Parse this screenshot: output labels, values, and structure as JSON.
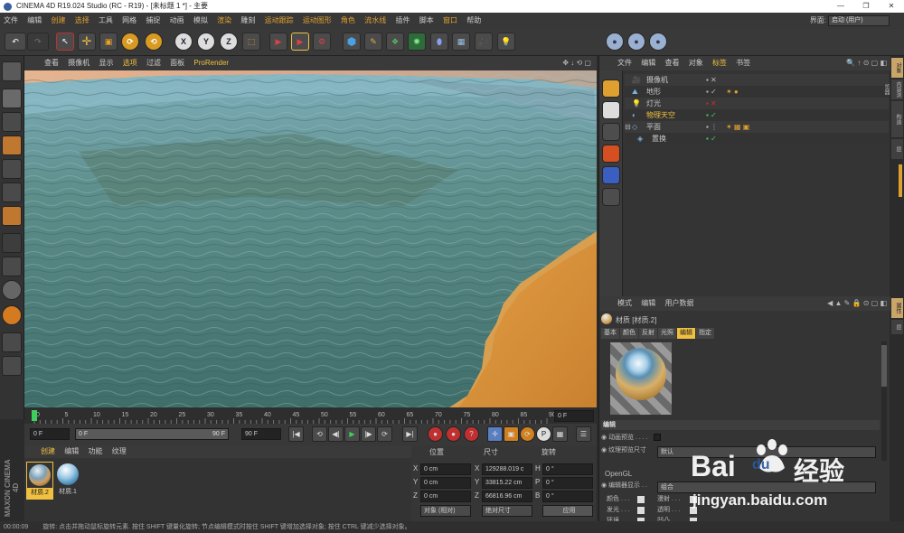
{
  "window": {
    "title": "CINEMA 4D R19.024 Studio (RC - R19) - [未标题 1 *] - 主要",
    "controls": [
      "—",
      "❐",
      "✕"
    ]
  },
  "menubar": {
    "items": [
      "文件",
      "编辑",
      "创建",
      "选择",
      "工具",
      "网格",
      "捕捉",
      "动画",
      "模拟",
      "渲染",
      "雕刻",
      "运动跟踪",
      "运动图形",
      "角色",
      "流水线",
      "插件",
      "脚本",
      "窗口",
      "帮助"
    ],
    "layout_label": "界面:",
    "layout_value": "启动 (用户)"
  },
  "toolbar": {
    "axis_x": "X",
    "axis_y": "Y",
    "axis_z": "Z"
  },
  "viewport": {
    "menu": [
      "查看",
      "摄像机",
      "显示",
      "选项",
      "过滤",
      "面板"
    ],
    "prorender": "ProRender"
  },
  "timeline": {
    "ticks": [
      "0",
      "5",
      "10",
      "15",
      "20",
      "25",
      "30",
      "35",
      "40",
      "45",
      "50",
      "55",
      "60",
      "65",
      "70",
      "75",
      "80",
      "85",
      "90"
    ],
    "end_field": "0 F",
    "current_frame": 0,
    "max_frame": 90
  },
  "playbar": {
    "start": "0 F",
    "range_start": "0 F",
    "range_end": "90 F",
    "end": "90 F"
  },
  "material_panel": {
    "tabs": [
      "创建",
      "编辑",
      "功能",
      "纹理"
    ],
    "materials": [
      {
        "name": "材质.2",
        "selected": true
      },
      {
        "name": "材质.1",
        "selected": false
      }
    ],
    "brand": [
      "MAXON",
      "CINEMA 4D"
    ]
  },
  "coords": {
    "headers": [
      "位置",
      "尺寸",
      "旋转"
    ],
    "rows": [
      {
        "axis": "X",
        "pos": "0 cm",
        "size_axis": "X",
        "size": "129288.019 c",
        "rot_axis": "H",
        "rot": "0 °"
      },
      {
        "axis": "Y",
        "pos": "0 cm",
        "size_axis": "Y",
        "size": "33815.22 cm",
        "rot_axis": "P",
        "rot": "0 °"
      },
      {
        "axis": "Z",
        "pos": "0 cm",
        "size_axis": "Z",
        "size": "66816.96 cm",
        "rot_axis": "B",
        "rot": "0 °"
      }
    ],
    "mode_select": "对象 (相对)",
    "size_select": "绝对尺寸",
    "apply": "应用"
  },
  "object_manager": {
    "menu": [
      "文件",
      "编辑",
      "查看",
      "对象",
      "标签",
      "书签"
    ],
    "objects": [
      {
        "name": "摄像机",
        "color": "#c8c8c8"
      },
      {
        "name": "地形",
        "color": "#c8c8c8"
      },
      {
        "name": "灯光",
        "color": "#c8c8c8"
      },
      {
        "name": "物理天空",
        "color": "#f0c040"
      },
      {
        "name": "平面",
        "color": "#c8c8c8"
      },
      {
        "name": "置换",
        "color": "#c8c8c8"
      }
    ]
  },
  "attribute_manager": {
    "menu": [
      "模式",
      "编辑",
      "用户数据"
    ],
    "title": "材质 [材质.2]",
    "tabs": [
      "基本",
      "颜色",
      "反射",
      "光照",
      "编辑",
      "指定"
    ],
    "active_tab": "编辑",
    "section": "编辑",
    "props": [
      {
        "label": "动画预览 . . . .",
        "value": ""
      },
      {
        "label": "纹理预览尺寸",
        "value": "默认"
      }
    ],
    "opengl_label": "OpenGL",
    "display_label": "编辑器显示 . .",
    "display_value": "组合",
    "channels": [
      [
        "颜色 . . .",
        "漫射 . . ."
      ],
      [
        "发光 . . .",
        "透明 . . ."
      ],
      [
        "环境 . . .",
        "凹凸 . . ."
      ]
    ]
  },
  "right_tabs": [
    "对象",
    "内容浏览器",
    "构造",
    "层",
    "属性",
    "层"
  ],
  "status": {
    "time": "00:00:09",
    "message": "旋转: 点击并拖动鼠标旋转元素. 按住 SHIFT 键量化旋转; 节点编辑模式时按住 SHIFT 键增加选择对象; 按住 CTRL 键减少选择对象。"
  },
  "watermark": {
    "text1": "Bai",
    "text2": "du",
    "text3": "经验",
    "url": "jingyan.baidu.com"
  }
}
